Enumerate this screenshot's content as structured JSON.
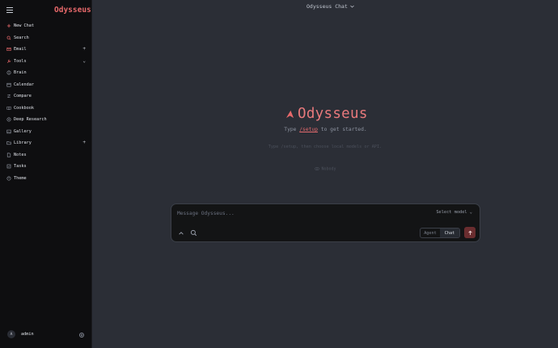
{
  "sidebar": {
    "brand": "Odysseus",
    "items": [
      {
        "label": "New Chat",
        "icon": "plus-icon"
      },
      {
        "label": "Search",
        "icon": "search-icon"
      },
      {
        "label": "Email",
        "icon": "mail-icon",
        "extra": "+"
      },
      {
        "label": "Tools",
        "icon": "wrench-icon",
        "extra": "⌄"
      },
      {
        "label": "Brain",
        "icon": "brain-icon"
      },
      {
        "label": "Calendar",
        "icon": "calendar-icon"
      },
      {
        "label": "Compare",
        "icon": "compare-icon"
      },
      {
        "label": "Cookbook",
        "icon": "book-icon"
      },
      {
        "label": "Deep Research",
        "icon": "research-icon"
      },
      {
        "label": "Gallery",
        "icon": "image-icon"
      },
      {
        "label": "Library",
        "icon": "folder-icon",
        "extra": "+"
      },
      {
        "label": "Notes",
        "icon": "note-icon"
      },
      {
        "label": "Tasks",
        "icon": "checklist-icon"
      },
      {
        "label": "Theme",
        "icon": "palette-icon"
      }
    ],
    "user": {
      "initial": "A",
      "name": "admin"
    }
  },
  "header": {
    "model_switch": "Odysseus Chat"
  },
  "hero": {
    "title": "Odysseus",
    "subtitle_pre": "Type ",
    "subtitle_cmd": "/setup",
    "subtitle_post": " to get started.",
    "hint": "Type /setup, then choose local models or API.",
    "presence": "Nobody"
  },
  "composer": {
    "placeholder": "Message Odysseus...",
    "model_select": "Select model ⌄",
    "modes": [
      "Agent",
      "Chat"
    ],
    "active_mode": "Chat"
  },
  "colors": {
    "accent": "#e8696b",
    "background": "#2b2e36",
    "sidebar": "#0e0e10",
    "send_button": "#6a2d2f"
  }
}
